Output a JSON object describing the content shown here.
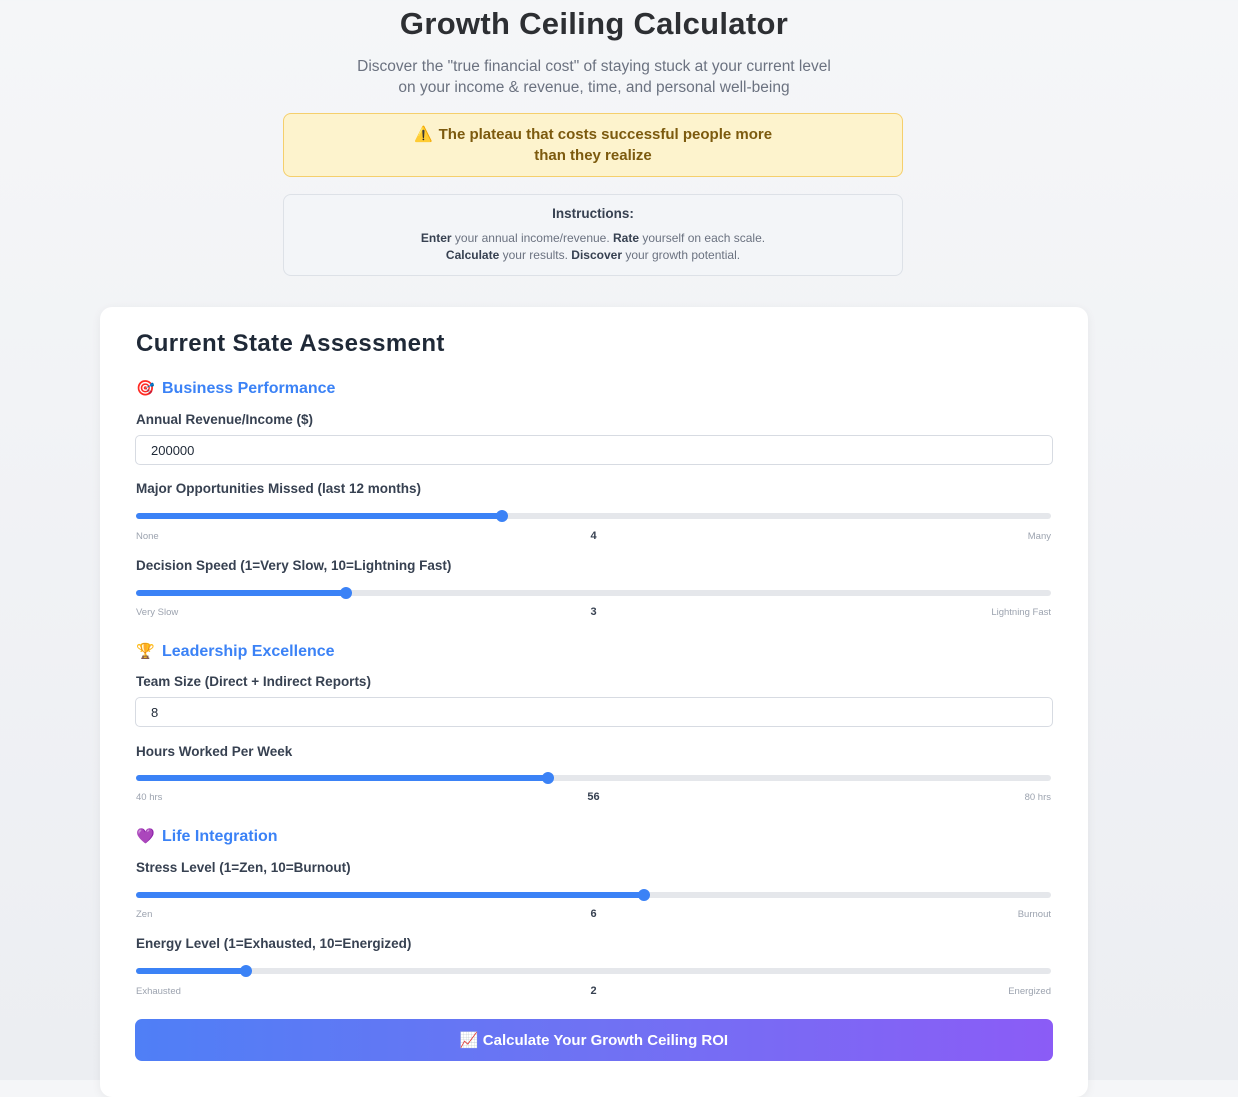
{
  "header": {
    "title": "Growth Ceiling Calculator",
    "subtitle_line1": "Discover the \"true financial cost\" of staying stuck at your current level",
    "subtitle_line2": "on your income & revenue, time, and personal well-being"
  },
  "warning": {
    "icon": "warning-icon",
    "icon_glyph": "⚠️",
    "line1": "The plateau that costs successful people more",
    "line2": "than they realize"
  },
  "instructions": {
    "title": "Instructions:",
    "line1_b1": "Enter",
    "line1_t1": " your annual income/revenue. ",
    "line1_b2": "Rate",
    "line1_t2": " yourself on each scale.",
    "line2_b1": "Calculate",
    "line2_t1": " your results. ",
    "line2_b2": "Discover",
    "line2_t2": " your growth potential."
  },
  "form": {
    "title": "Current State Assessment",
    "sections": {
      "business": {
        "icon": "target-icon",
        "glyph": "🎯",
        "label": "Business Performance"
      },
      "leadership": {
        "icon": "trophy-icon",
        "glyph": "🏆",
        "label": "Leadership Excellence"
      },
      "life": {
        "icon": "heart-icon",
        "glyph": "💜",
        "label": "Life Integration"
      }
    },
    "revenue": {
      "label": "Annual Revenue/Income ($)",
      "value": "200000"
    },
    "opportunities": {
      "label": "Major Opportunities Missed (last 12 months)",
      "value": "4",
      "min_label": "None",
      "max_label": "Many",
      "fraction": 0.4
    },
    "decision": {
      "label": "Decision Speed (1=Very Slow, 10=Lightning Fast)",
      "value": "3",
      "min_label": "Very Slow",
      "max_label": "Lightning Fast",
      "fraction": 0.23
    },
    "team": {
      "label": "Team Size (Direct + Indirect Reports)",
      "value": "8"
    },
    "hours": {
      "label": "Hours Worked Per Week",
      "value": "56",
      "min_label": "40 hrs",
      "max_label": "80 hrs",
      "fraction": 0.45
    },
    "stress": {
      "label": "Stress Level (1=Zen, 10=Burnout)",
      "value": "6",
      "min_label": "Zen",
      "max_label": "Burnout",
      "fraction": 0.555
    },
    "energy": {
      "label": "Energy Level (1=Exhausted, 10=Energized)",
      "value": "2",
      "min_label": "Exhausted",
      "max_label": "Energized",
      "fraction": 0.12
    },
    "calculate_label": "📈 Calculate Your Growth Ceiling ROI"
  },
  "colors": {
    "accent": "#3b82f6",
    "gradient_start": "#4f7ff6",
    "gradient_end": "#8b5cf6",
    "warning_bg": "#fdf3cd"
  }
}
